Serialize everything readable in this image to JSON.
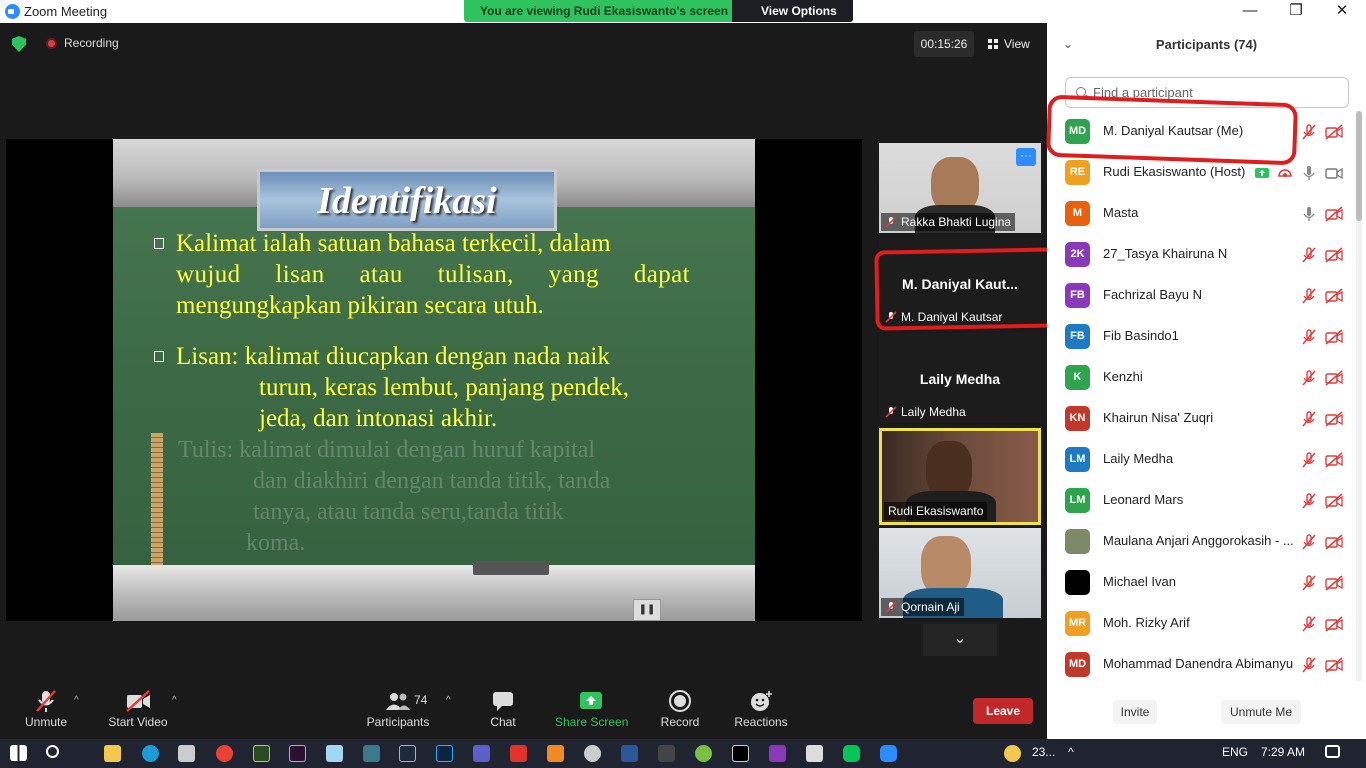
{
  "window": {
    "title": "Zoom Meeting",
    "minimize": "—",
    "restore": "❐",
    "close": "✕"
  },
  "banner": {
    "message": "You are viewing Rudi Ekasiswanto's screen",
    "options_label": "View Options",
    "options_caret": "⌄"
  },
  "top": {
    "recording_label": "Recording",
    "timer": "00:15:26",
    "view_label": "View"
  },
  "slide": {
    "title": "Identifikasi",
    "bullet1": [
      "Kalimat ialah satuan bahasa terkecil, dalam",
      "wujud lisan atau tulisan, yang dapat",
      "mengungkapkan pikiran secara utuh."
    ],
    "bullet2": [
      "Lisan: kalimat diucapkan dengan nada naik",
      "turun, keras lembut, panjang pendek,",
      "jeda, dan intonasi akhir."
    ],
    "faded": [
      "Tulis: kalimat dimulai dengan huruf kapital",
      "dan diakhiri dengan tanda titik, tanda",
      "tanya, atau tanda seru,tanda titik",
      "koma."
    ],
    "pause_icon": "❚❚"
  },
  "thumbnails": [
    {
      "name": "Rakka Bhakti Lugina",
      "more": "···"
    },
    {
      "big_name": "M. Daniyal Kaut...",
      "name": "M. Daniyal Kautsar"
    },
    {
      "big_name": "Laily Medha",
      "name": "Laily Medha"
    },
    {
      "name": "Rudi Ekasiswanto"
    },
    {
      "name": "Qornain Aji"
    }
  ],
  "scroll_down": "⌄",
  "toolbar": {
    "unmute": "Unmute",
    "start_video": "Start Video",
    "participants": "Participants",
    "participants_count": "74",
    "chat": "Chat",
    "share_screen": "Share Screen",
    "record": "Record",
    "reactions": "Reactions",
    "leave": "Leave",
    "caret": "^"
  },
  "panel": {
    "collapse": "⌄",
    "title": "Participants (74)",
    "search_placeholder": "Find a participant",
    "participants": [
      {
        "initials": "MD",
        "name": "M. Daniyal Kautsar (Me)",
        "color": "#2ea44f",
        "mic": "muted",
        "video": "off"
      },
      {
        "initials": "RE",
        "name": "Rudi Ekasiswanto (Host)",
        "color": "#f0a020",
        "mic": "on",
        "video": "on",
        "sharing": true
      },
      {
        "initials": "M",
        "name": "Masta",
        "color": "#e8610f",
        "mic": "on",
        "video": "off"
      },
      {
        "initials": "2K",
        "name": "27_Tasya Khairuna N",
        "color": "#8a3ab9",
        "mic": "muted",
        "video": "off"
      },
      {
        "initials": "FB",
        "name": "Fachrizal Bayu N",
        "color": "#8a3ab9",
        "mic": "muted",
        "video": "off"
      },
      {
        "initials": "FB",
        "name": "Fib Basindo1",
        "color": "#1e7bc3",
        "mic": "muted",
        "video": "off"
      },
      {
        "initials": "K",
        "name": "Kenzhi",
        "color": "#2ea44f",
        "mic": "muted",
        "video": "off"
      },
      {
        "initials": "KN",
        "name": "Khairun Nisa' Zuqri",
        "color": "#c0392b",
        "mic": "muted",
        "video": "off"
      },
      {
        "initials": "LM",
        "name": "Laily Medha",
        "color": "#1e7bc3",
        "mic": "muted",
        "video": "off"
      },
      {
        "initials": "LM",
        "name": "Leonard Mars",
        "color": "#2ea44f",
        "mic": "muted",
        "video": "off"
      },
      {
        "initials": "",
        "name": "Maulana Anjari Anggorokasih - ...",
        "color": "#7c8a6a",
        "mic": "muted",
        "video": "off"
      },
      {
        "initials": "",
        "name": "Michael Ivan",
        "color": "#000000",
        "mic": "muted",
        "video": "off"
      },
      {
        "initials": "MR",
        "name": "Moh. Rizky Arif",
        "color": "#f0a020",
        "mic": "muted",
        "video": "off"
      },
      {
        "initials": "MD",
        "name": "Mohammad Danendra Abimanyu",
        "color": "#c0392b",
        "mic": "muted",
        "video": "off"
      }
    ],
    "invite": "Invite",
    "unmute_me": "Unmute Me"
  },
  "taskbar": {
    "weather": "23...",
    "lang": "ENG",
    "time": "7:29 AM"
  }
}
